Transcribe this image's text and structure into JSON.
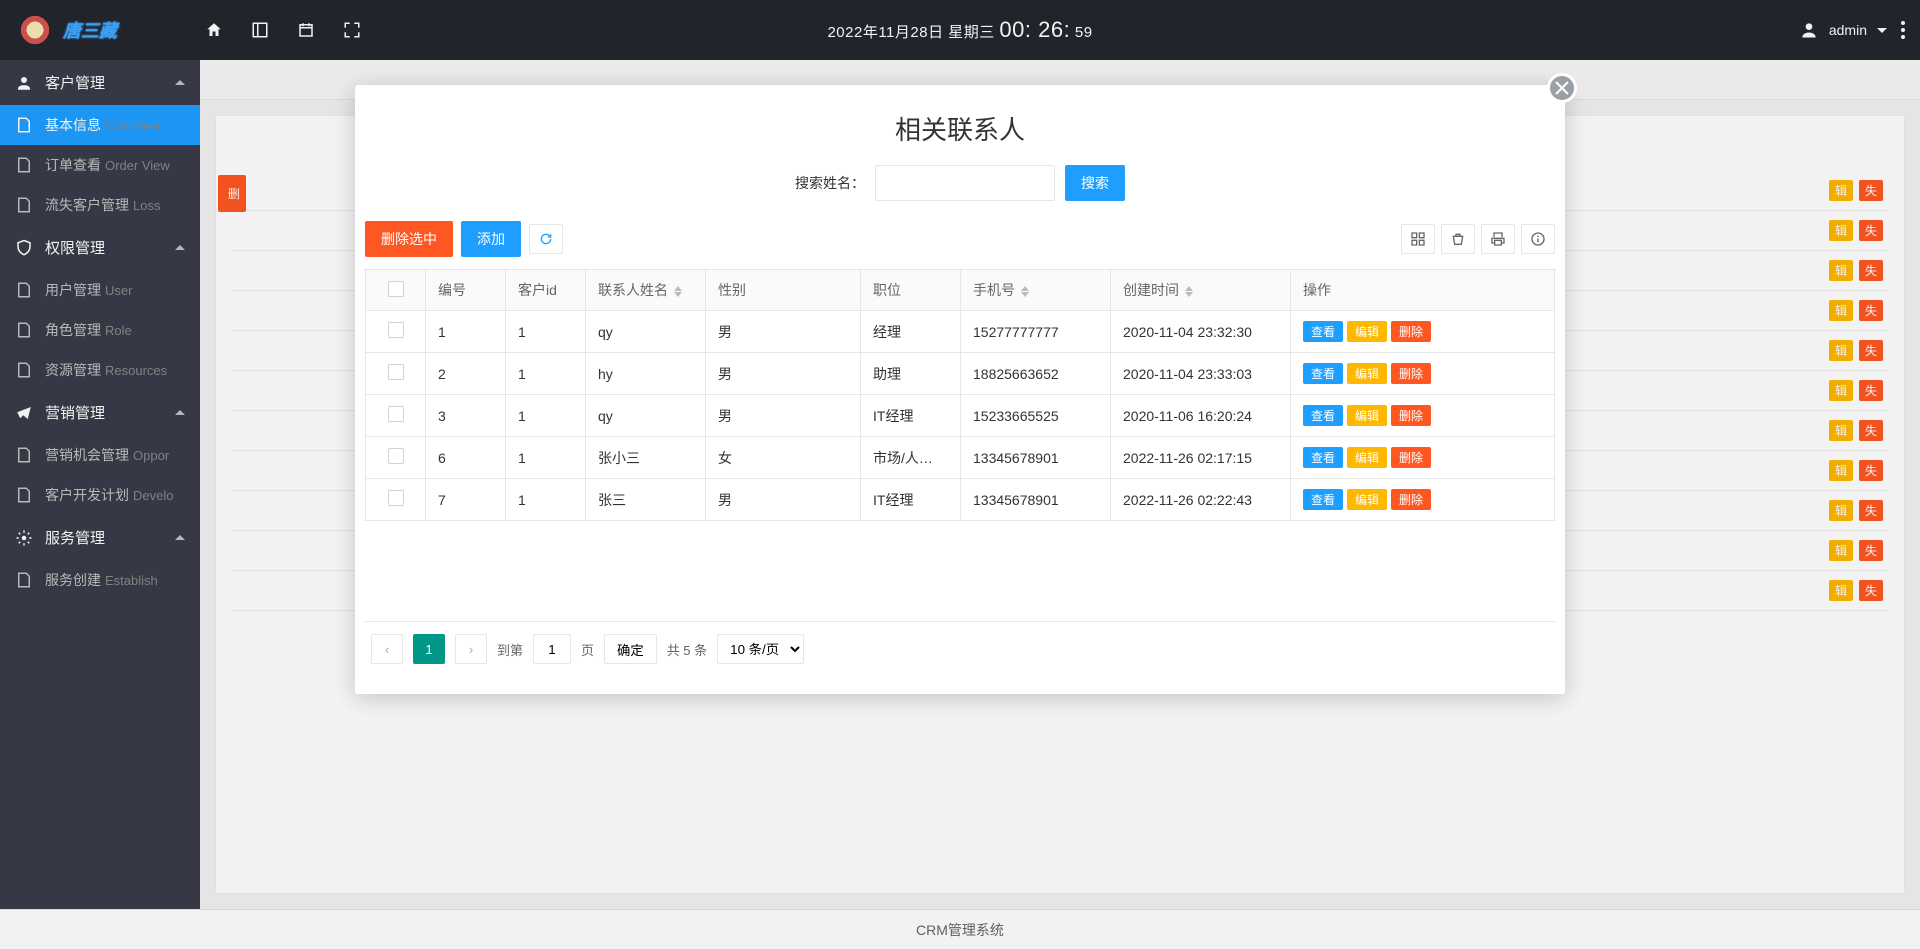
{
  "header": {
    "datetime_prefix": "2022年11月28日 星期三 ",
    "time_hm": "00: 26:",
    "time_s": " 59",
    "username": "admin"
  },
  "sidebar": {
    "groups": [
      {
        "label": "客户管理",
        "items": [
          {
            "label": "基本信息",
            "sub": "Customer",
            "active": true
          },
          {
            "label": "订单查看",
            "sub": "Order View"
          },
          {
            "label": "流失客户管理",
            "sub": "Loss"
          }
        ]
      },
      {
        "label": "权限管理",
        "items": [
          {
            "label": "用户管理",
            "sub": "User"
          },
          {
            "label": "角色管理",
            "sub": "Role"
          },
          {
            "label": "资源管理",
            "sub": "Resources"
          }
        ]
      },
      {
        "label": "营销管理",
        "items": [
          {
            "label": "营销机会管理",
            "sub": "Oppor"
          },
          {
            "label": "客户开发计划",
            "sub": "Develo"
          }
        ]
      },
      {
        "label": "服务管理",
        "items": [
          {
            "label": "服务创建",
            "sub": "Establish"
          }
        ]
      }
    ]
  },
  "main_bg": {
    "del_fragment": "删",
    "loss_label": "失",
    "edit_label": "辑"
  },
  "modal": {
    "title": "相关联系人",
    "search_label": "搜索姓名：",
    "search_btn": "搜索",
    "del_selected": "删除选中",
    "add": "添加",
    "columns": [
      "编号",
      "客户id",
      "联系人姓名",
      "性别",
      "职位",
      "手机号",
      "创建时间",
      "操作"
    ],
    "rows": [
      {
        "id": "1",
        "cid": "1",
        "name": "qy",
        "sex": "男",
        "pos": "经理",
        "phone": "15277777777",
        "time": "2020-11-04 23:32:30"
      },
      {
        "id": "2",
        "cid": "1",
        "name": "hy",
        "sex": "男",
        "pos": "助理",
        "phone": "18825663652",
        "time": "2020-11-04 23:33:03"
      },
      {
        "id": "3",
        "cid": "1",
        "name": "qy",
        "sex": "男",
        "pos": "IT经理",
        "phone": "15233665525",
        "time": "2020-11-06 16:20:24"
      },
      {
        "id": "6",
        "cid": "1",
        "name": "张小三",
        "sex": "女",
        "pos": "市场/人…",
        "phone": "13345678901",
        "time": "2022-11-26 02:17:15"
      },
      {
        "id": "7",
        "cid": "1",
        "name": "张三",
        "sex": "男",
        "pos": "IT经理",
        "phone": "13345678901",
        "time": "2022-11-26 02:22:43"
      }
    ],
    "ops": {
      "view": "查看",
      "edit": "编辑",
      "del": "删除"
    },
    "pager": {
      "to_page": "到第",
      "page_unit": "页",
      "confirm": "确定",
      "total": "共 5 条",
      "per_page": "10 条/页",
      "current": "1",
      "input": "1"
    }
  },
  "footer": {
    "text": "CRM管理系统"
  }
}
